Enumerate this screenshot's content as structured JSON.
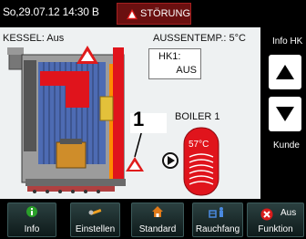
{
  "status_bar": {
    "datetime": "So,29.07.12 14:30 B",
    "alarm_text": "STÖRUNG"
  },
  "main": {
    "kessel_label": "KESSEL: Aus",
    "aussen_label": "AUSSENTEMP.:  5°C",
    "hk_title": "HK1:",
    "hk_value": "AUS",
    "boiler_label": "BOILER 1",
    "boiler_temp": "57°C",
    "callout_number": "1"
  },
  "right_panel": {
    "info_hk_label": "Info HK",
    "kunde_label": "Kunde"
  },
  "bottom_bar": {
    "info": "Info",
    "einstellen": "Einstellen",
    "standard": "Standard",
    "rauchfang": "Rauchfang",
    "aus_top": "Aus",
    "funktion": "Funktion"
  },
  "colors": {
    "alarm_red": "#e01b1b",
    "boiler_red": "#e0141c",
    "boiler_accent": "#ff8c00",
    "button_bg": "#1f3030"
  }
}
